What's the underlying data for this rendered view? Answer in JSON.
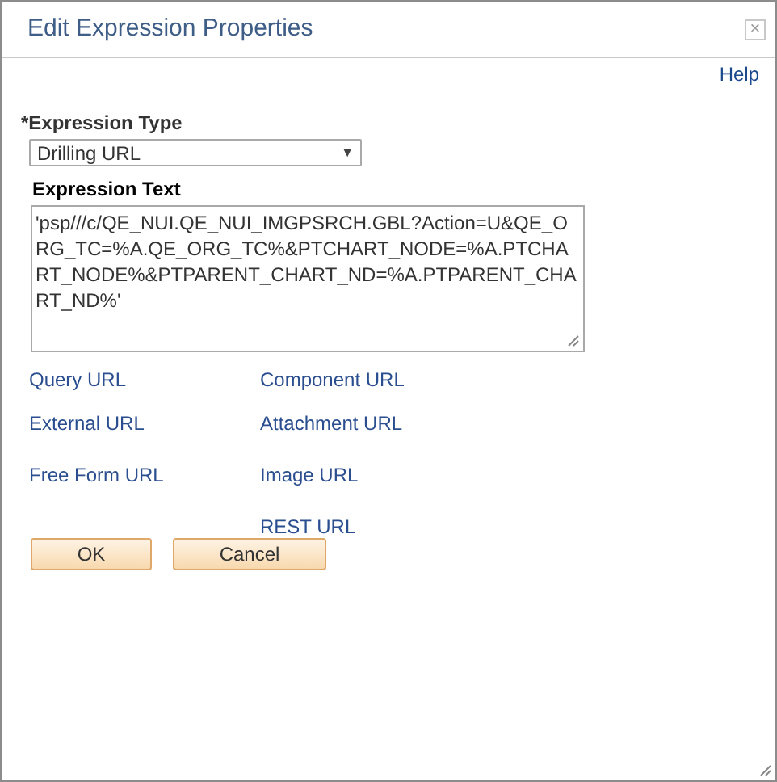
{
  "window": {
    "title": "Edit Expression Properties",
    "close": "×"
  },
  "help_link": "Help",
  "expression_type": {
    "required_mark": "*",
    "label": "Expression Type",
    "value": "Drilling URL",
    "arrow": "▼"
  },
  "expression_text": {
    "label": "Expression Text",
    "value": "'psp///c/QE_NUI.QE_NUI_IMGPSRCH.GBL?Action=U&QE_ORG_TC=%A.QE_ORG_TC%&PTCHART_NODE=%A.PTCHART_NODE%&PTPARENT_CHART_ND=%A.PTPARENT_CHART_ND%'"
  },
  "link_rows": [
    {
      "left": "Query URL",
      "right": "Component URL"
    },
    {
      "left": "External URL",
      "right": "Attachment URL"
    },
    {
      "left": "Free Form URL",
      "right": "Image URL"
    },
    {
      "right": "REST URL"
    }
  ],
  "buttons": [
    "OK",
    "Cancel"
  ]
}
